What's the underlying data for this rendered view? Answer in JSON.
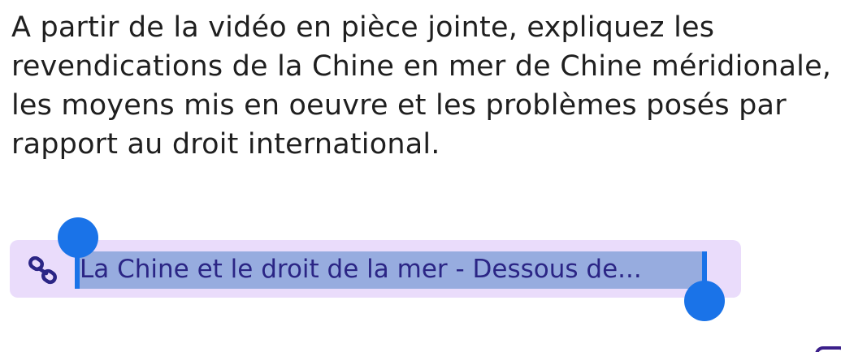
{
  "assignment": {
    "instruction": "A partir de la vidéo en pièce jointe, expliquez les revendications de la Chine en mer de Chine méridionale, les moyens mis en oeuvre et les problèmes posés par rapport au droit international."
  },
  "attachment": {
    "icon": "link-icon",
    "title": "La Chine et le droit de la mer - Dessous de...",
    "chip_color": "#eadcfb",
    "text_color": "#2b2585",
    "selection_color": "#97acdf",
    "handle_color": "#1a73e8"
  }
}
